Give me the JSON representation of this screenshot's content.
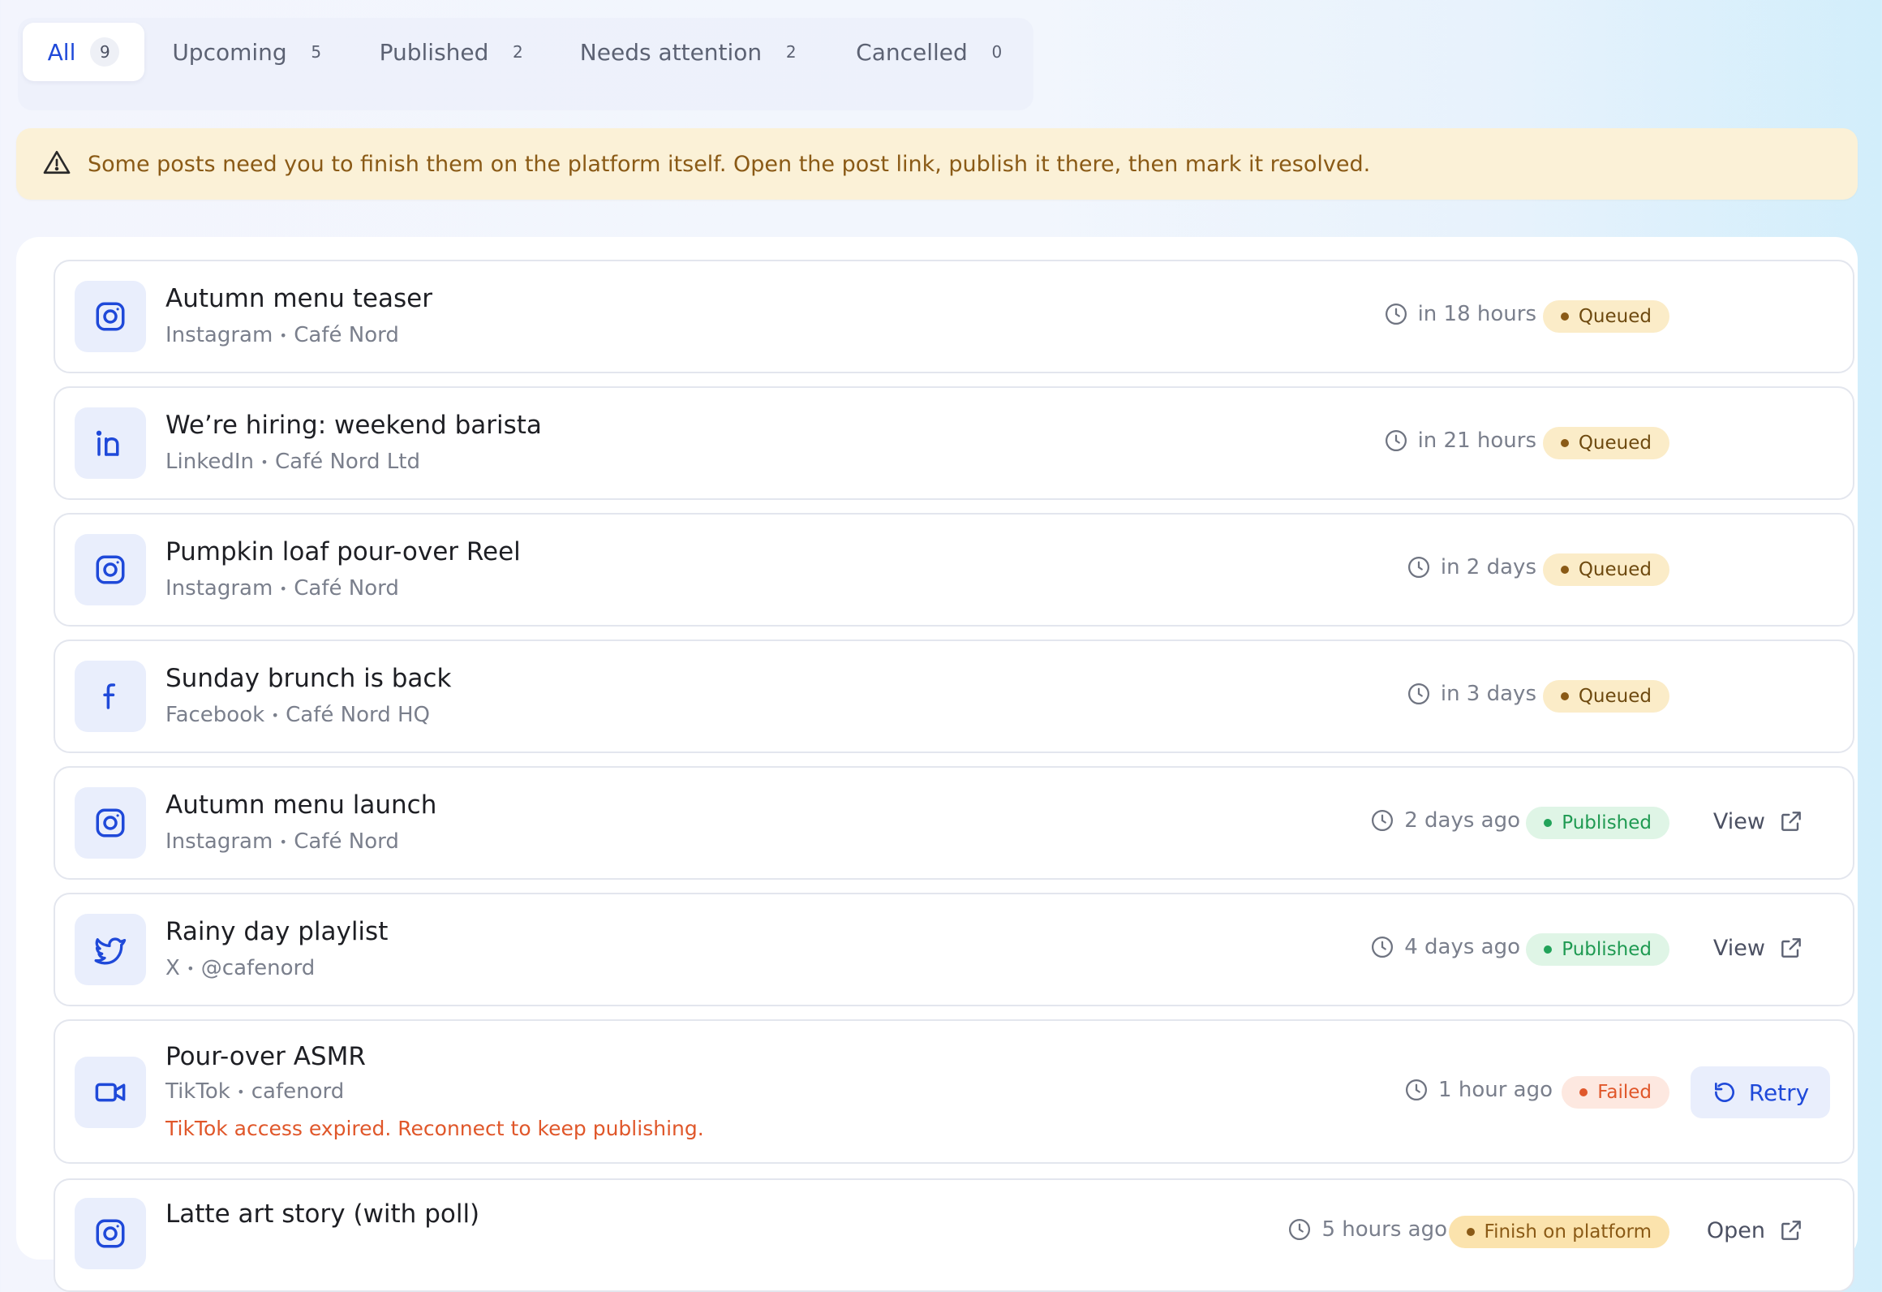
{
  "tabs": [
    {
      "label": "All",
      "count": "9"
    },
    {
      "label": "Upcoming",
      "count": "5"
    },
    {
      "label": "Published",
      "count": "2"
    },
    {
      "label": "Needs attention",
      "count": "2"
    },
    {
      "label": "Cancelled",
      "count": "0"
    }
  ],
  "banner": {
    "icon": "warning-triangle-icon",
    "text": "Some posts need you to finish them on the platform itself. Open the post link, publish it there, then mark it resolved."
  },
  "colors": {
    "accent": "#1f49d9",
    "queued": "#6e4a10",
    "published": "#1f9a52",
    "failed": "#e0572a",
    "banner_bg": "#fbf1d7"
  },
  "posts": [
    {
      "title": "Autumn menu teaser",
      "platform": "Instagram",
      "account": "Café Nord",
      "sep": "•",
      "time": "in 18 hours",
      "status": "Queued",
      "icon": "instagram-icon"
    },
    {
      "title": "We’re hiring: weekend barista",
      "platform": "LinkedIn",
      "account": "Café Nord Ltd",
      "sep": "•",
      "time": "in 21 hours",
      "status": "Queued",
      "icon": "linkedin-icon"
    },
    {
      "title": "Pumpkin loaf pour-over Reel",
      "platform": "Instagram",
      "account": "Café Nord",
      "sep": "•",
      "time": "in 2 days",
      "status": "Queued",
      "icon": "instagram-icon"
    },
    {
      "title": "Sunday brunch is back",
      "platform": "Facebook",
      "account": "Café Nord HQ",
      "sep": "•",
      "time": "in 3 days",
      "status": "Queued",
      "icon": "facebook-icon"
    },
    {
      "title": "Autumn menu launch",
      "platform": "Instagram",
      "account": "Café Nord",
      "sep": "•",
      "time": "2 days ago",
      "status": "Published",
      "action": "View",
      "icon": "instagram-icon"
    },
    {
      "title": "Rainy day playlist",
      "platform": "X",
      "account": "@cafenord",
      "sep": "•",
      "time": "4 days ago",
      "status": "Published",
      "action": "View",
      "icon": "twitter-bird-icon"
    },
    {
      "title": "Pour-over ASMR",
      "platform": "TikTok",
      "account": "cafenord",
      "sep": "•",
      "time": "1 hour ago",
      "status": "Failed",
      "error": "TikTok access expired. Reconnect to keep publishing.",
      "action": "Retry",
      "icon": "video-camera-icon"
    },
    {
      "title": "Latte art story (with poll)",
      "time": "5 hours ago",
      "status": "Finish on platform",
      "action": "Open",
      "icon": "instagram-icon"
    }
  ]
}
